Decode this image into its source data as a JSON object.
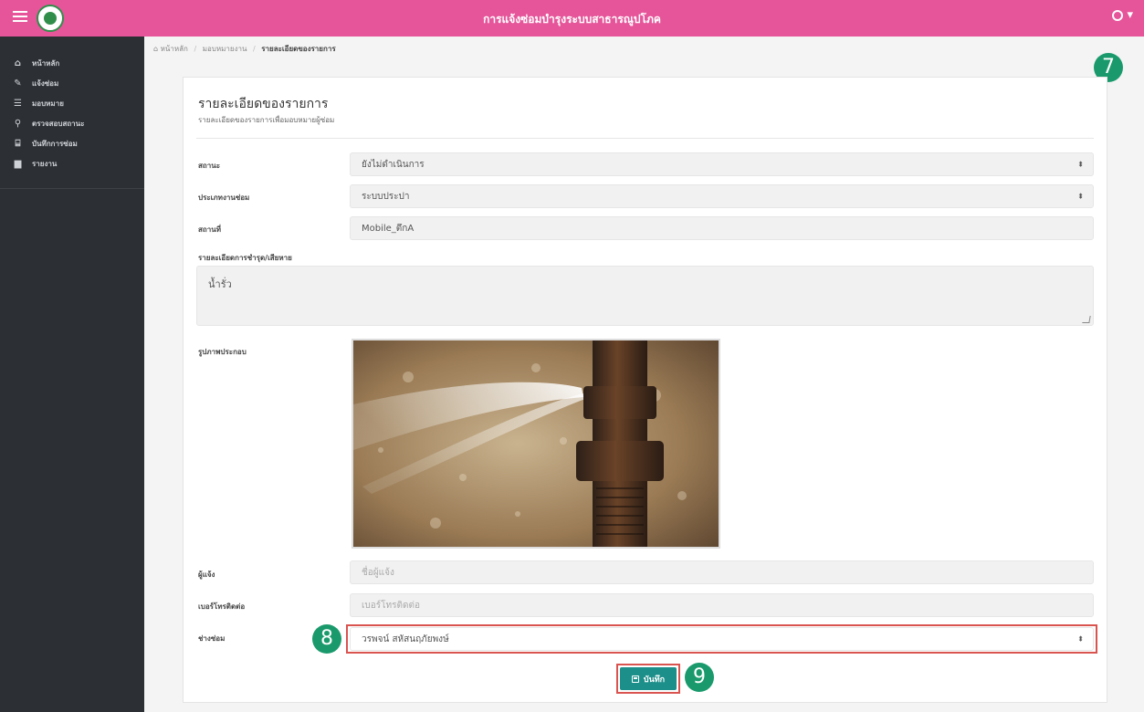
{
  "header": {
    "title": "การแจ้งซ่อมบำรุงระบบสาธารณูปโภค",
    "user_caret": "▾"
  },
  "sidebar": {
    "items": [
      {
        "label": "หน้าหลัก",
        "icon": "home-icon"
      },
      {
        "label": "แจ้งซ่อม",
        "icon": "wrench-icon"
      },
      {
        "label": "มอบหมาย",
        "icon": "list-icon"
      },
      {
        "label": "ตรวจสอบสถานะ",
        "icon": "search-icon"
      },
      {
        "label": "บันทึกการซ่อม",
        "icon": "tray-icon"
      },
      {
        "label": "รายงาน",
        "icon": "document-icon"
      }
    ]
  },
  "breadcrumb": {
    "home": "หน้าหลัก",
    "parent": "มอบหมายงาน",
    "current": "รายละเอียดของรายการ"
  },
  "badges": {
    "b7": "7",
    "b8": "8",
    "b9": "9"
  },
  "card": {
    "title": "รายละเอียดของรายการ",
    "subtitle": "รายละเอียดของรายการเพื่อมอบหมายผู้ซ่อม"
  },
  "form": {
    "status_label": "สถานะ",
    "status_value": "ยังไม่ดำเนินการ",
    "type_label": "ประเภทงานซ่อม",
    "type_value": "ระบบประปา",
    "location_label": "สถานที่",
    "location_value": "Mobile_ตึกA",
    "detail_label": "รายละเอียดการชำรุด/เสียหาย",
    "detail_value": "น้ำรั่ว",
    "photo_label": "รูปภาพประกอบ",
    "reporter_label": "ผู้แจ้ง",
    "reporter_placeholder": "ชื่อผู้แจ้ง",
    "phone_label": "เบอร์โทรติดต่อ",
    "phone_placeholder": "เบอร์โทรติดต่อ",
    "technician_label": "ช่างซ่อม",
    "technician_value": "วรพจน์ สหัสนฤภัยพงษ์",
    "save_label": "บันทึก"
  },
  "colors": {
    "header": "#e6559a",
    "sidebar": "#2c2f33",
    "badge": "#1a9a6c",
    "save_button": "#1c8f8a",
    "highlight": "#d9534f"
  }
}
